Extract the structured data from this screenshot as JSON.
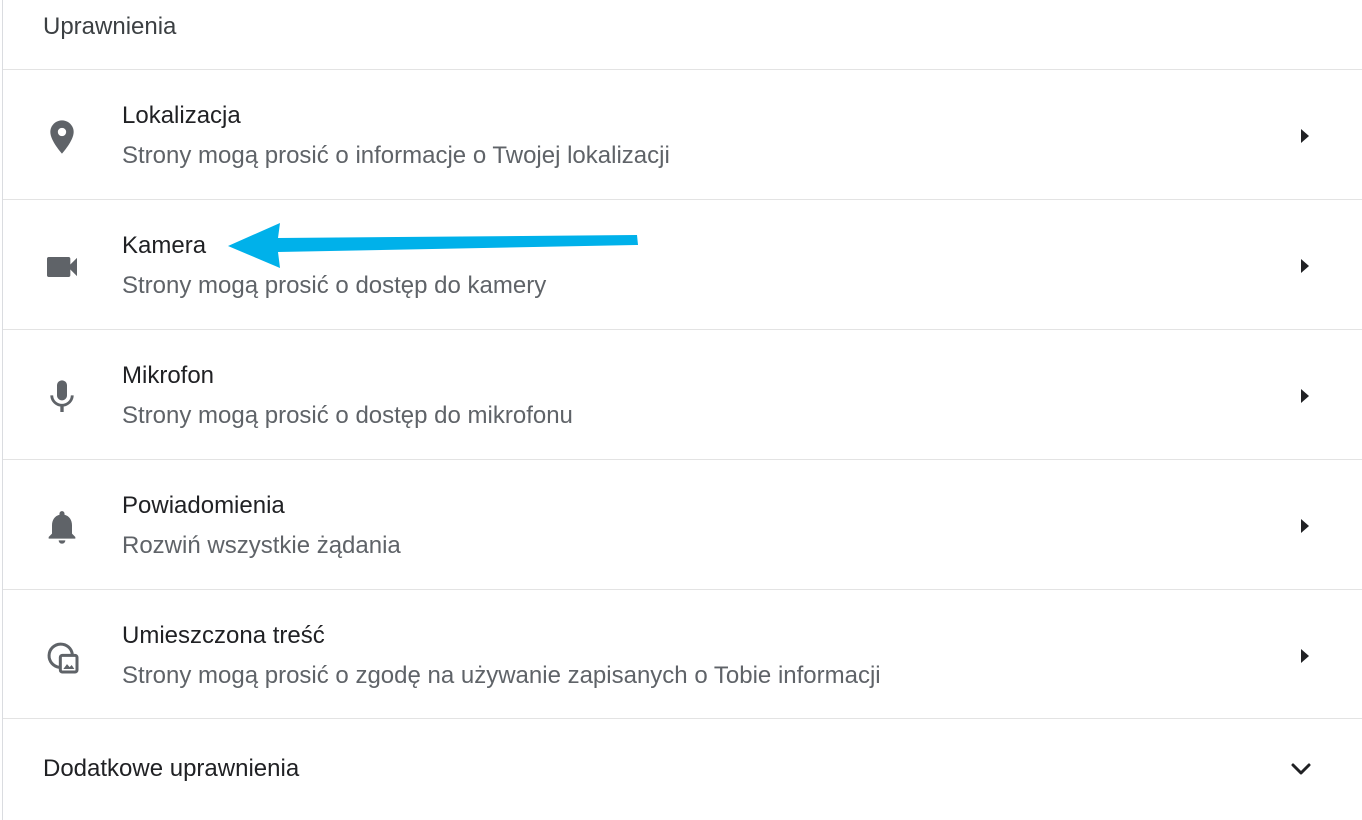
{
  "section": {
    "title": "Uprawnienia"
  },
  "permissions": [
    {
      "icon": "location-pin-icon",
      "title": "Lokalizacja",
      "subtitle": "Strony mogą prosić o informacje o Twojej lokalizacji"
    },
    {
      "icon": "camera-icon",
      "title": "Kamera",
      "subtitle": "Strony mogą prosić o dostęp do kamery"
    },
    {
      "icon": "microphone-icon",
      "title": "Mikrofon",
      "subtitle": "Strony mogą prosić o dostęp do mikrofonu"
    },
    {
      "icon": "bell-icon",
      "title": "Powiadomienia",
      "subtitle": "Rozwiń wszystkie żądania"
    },
    {
      "icon": "embedded-content-icon",
      "title": "Umieszczona treść",
      "subtitle": "Strony mogą prosić o zgodę na używanie zapisanych o Tobie informacji"
    }
  ],
  "additional": {
    "label": "Dodatkowe uprawnienia",
    "icon": "chevron-down-icon"
  },
  "annotation": {
    "icon": "annotation-arrow-icon",
    "color": "#00b1ea"
  },
  "colors": {
    "icon": "#5f6368",
    "chevron": "#202124",
    "divider": "#e3e3e3"
  }
}
